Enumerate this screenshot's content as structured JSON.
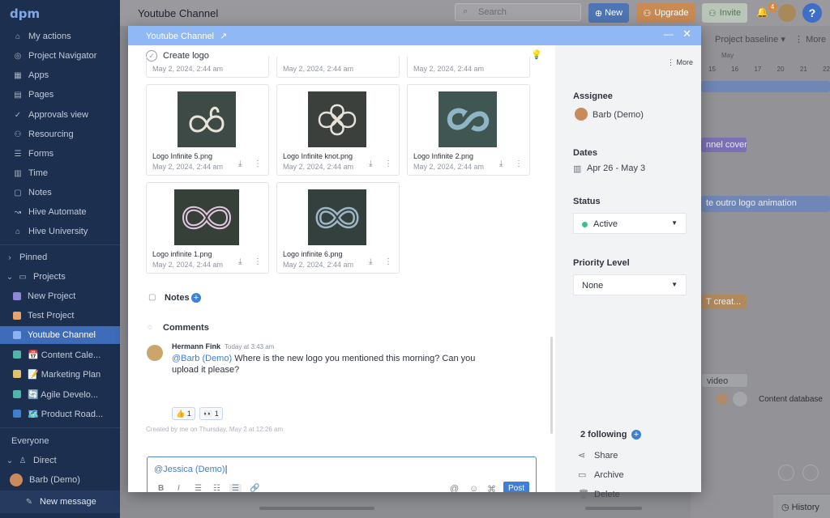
{
  "app": {
    "logo": "dpm",
    "page_title": "Youtube Channel"
  },
  "sidebar": {
    "items": [
      {
        "label": "My actions",
        "icon": "home-icon"
      },
      {
        "label": "Project Navigator",
        "icon": "compass-icon"
      },
      {
        "label": "Apps",
        "icon": "grid-icon"
      },
      {
        "label": "Pages",
        "icon": "pages-icon"
      },
      {
        "label": "Approvals view",
        "icon": "check-circle-icon"
      },
      {
        "label": "Resourcing",
        "icon": "people-icon"
      },
      {
        "label": "Forms",
        "icon": "form-icon"
      },
      {
        "label": "Time",
        "icon": "calendar-icon"
      },
      {
        "label": "Notes",
        "icon": "note-icon"
      },
      {
        "label": "Hive Automate",
        "icon": "automate-icon"
      },
      {
        "label": "Hive University",
        "icon": "graduation-icon"
      }
    ],
    "pinned": "Pinned",
    "projects": "Projects",
    "project_list": [
      {
        "label": "New Project",
        "color": "#8f86d6"
      },
      {
        "label": "Test Project",
        "color": "#e6a36c"
      },
      {
        "label": "Youtube Channel",
        "color": "#8fb1f0"
      },
      {
        "label": "📅 Content Cale...",
        "color": "#4fb5a8"
      },
      {
        "label": "📝 Marketing Plan",
        "color": "#e2c26a"
      },
      {
        "label": "🔄 Agile Develo...",
        "color": "#4fb5a8"
      },
      {
        "label": "🗺️ Product Road...",
        "color": "#3e7fd0"
      }
    ],
    "everyone": "Everyone",
    "direct": "Direct",
    "direct_user": "Barb (Demo)",
    "new_message": "New message"
  },
  "topbar": {
    "search_placeholder": "Search",
    "new_label": "New",
    "upgrade_label": "Upgrade",
    "invite_label": "Invite",
    "notification_count": "4",
    "help": "?"
  },
  "background": {
    "project_baseline": "Project baseline",
    "more": "More",
    "month": "May",
    "days": [
      "15",
      "16",
      "17",
      "20",
      "21",
      "22"
    ],
    "bars": [
      "nnel cover",
      "te outro logo animation",
      "T creat...",
      "video"
    ],
    "content_database": "Content database",
    "history": "History"
  },
  "modal": {
    "header_title": "Youtube Channel",
    "task_title": "Create logo",
    "files_date_top": "May 2, 2024, 2:44 am",
    "files": [
      {
        "name": "Logo Infinite 5.png",
        "date": "May 2, 2024, 2:44 am"
      },
      {
        "name": "Logo Infinite knot.png",
        "date": "May 2, 2024, 2:44 am"
      },
      {
        "name": "Logo Infinite 2.png",
        "date": "May 2, 2024, 2:44 am"
      },
      {
        "name": "Logo infinite 1.png",
        "date": "May 2, 2024, 2:44 am"
      },
      {
        "name": "Logo infinite 6.png",
        "date": "May 2, 2024, 2:44 am"
      }
    ],
    "notes_label": "Notes",
    "comments_label": "Comments",
    "comment": {
      "author": "Hermann Fink",
      "time": "Today at 3:43 am",
      "mention": "@Barb (Demo)",
      "text_line1": " Where is the new logo you mentioned this morning? Can you",
      "text_line2": "upload it please?",
      "reactions": [
        {
          "emoji": "👍",
          "count": "1"
        },
        {
          "emoji": "👀",
          "count": "1"
        }
      ]
    },
    "created_by": "Created by me on Thursday, May 2 at 12:26 am",
    "input_value": "@Jessica (Demo)",
    "post_label": "Post"
  },
  "details": {
    "more": "More",
    "assignee_label": "Assignee",
    "assignee": "Barb (Demo)",
    "dates_label": "Dates",
    "dates": "Apr 26 - May 3",
    "status_label": "Status",
    "status": "Active",
    "status_color": "#3fbf8a",
    "priority_label": "Priority Level",
    "priority": "None",
    "following": "2 following",
    "share": "Share",
    "archive": "Archive",
    "delete": "Delete"
  }
}
